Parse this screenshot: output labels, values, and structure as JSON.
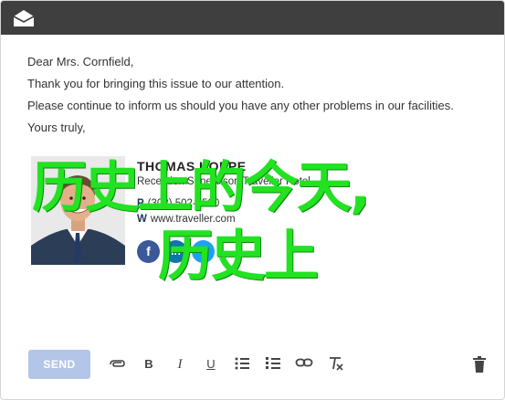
{
  "window": {
    "header_icon": "envelope-open-icon"
  },
  "letter": {
    "greeting": "Dear Mrs. Cornfield,",
    "line1": "Thank you for bringing this issue to our attention.",
    "line2": "Please continue to inform us should you have any other problems in our facilities.",
    "closing": "Yours truly,"
  },
  "signature": {
    "name": "THOMAS KOPPE",
    "role": "Reception Supervisor, Traveller Hotel",
    "phone_label": "P",
    "phone": "(302) 502-6520",
    "web_label": "W",
    "website": "www.traveller.com",
    "social": {
      "facebook_glyph": "f",
      "linkedin_glyph": "in",
      "twitter_glyph": "t"
    }
  },
  "overlay": {
    "line1": "历史上的今天,",
    "line2": "历史上",
    "color": "#22e222"
  },
  "toolbar": {
    "send_label": "SEND",
    "send_color": "#b4c6e7",
    "bold_glyph": "B",
    "italic_glyph": "I",
    "underline_glyph": "U"
  }
}
